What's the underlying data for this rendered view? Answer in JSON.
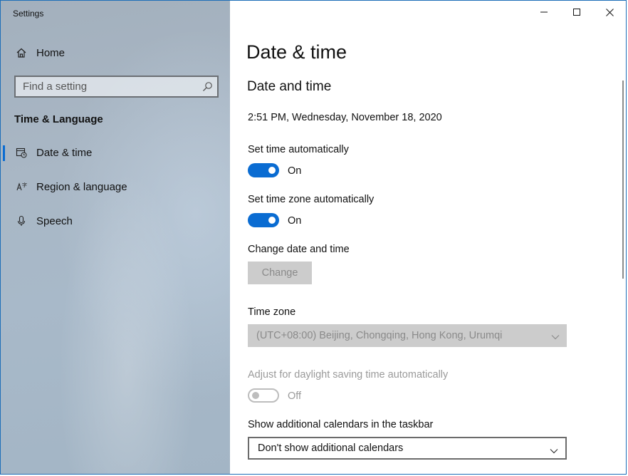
{
  "app": {
    "title": "Settings"
  },
  "sidebar": {
    "home_label": "Home",
    "search_placeholder": "Find a setting",
    "section_label": "Time & Language",
    "items": [
      {
        "label": "Date & time",
        "icon": "calendar-clock-icon",
        "active": true
      },
      {
        "label": "Region & language",
        "icon": "language-icon",
        "active": false
      },
      {
        "label": "Speech",
        "icon": "microphone-icon",
        "active": false
      }
    ]
  },
  "main": {
    "page_title": "Date & time",
    "section_title": "Date and time",
    "current_time": "2:51 PM, Wednesday, November 18, 2020",
    "set_time_auto": {
      "label": "Set time automatically",
      "state": "On"
    },
    "set_timezone_auto": {
      "label": "Set time zone automatically",
      "state": "On"
    },
    "change_date_time": {
      "label": "Change date and time",
      "button": "Change"
    },
    "time_zone": {
      "label": "Time zone",
      "value": "(UTC+08:00) Beijing, Chongqing, Hong Kong, Urumqi"
    },
    "daylight": {
      "label": "Adjust for daylight saving time automatically",
      "state": "Off"
    },
    "calendars": {
      "label": "Show additional calendars in the taskbar",
      "value": "Don't show additional calendars"
    }
  },
  "colors": {
    "accent": "#0a6cd2",
    "disabled_bg": "#cccccc",
    "disabled_text": "#8a8a8a"
  }
}
